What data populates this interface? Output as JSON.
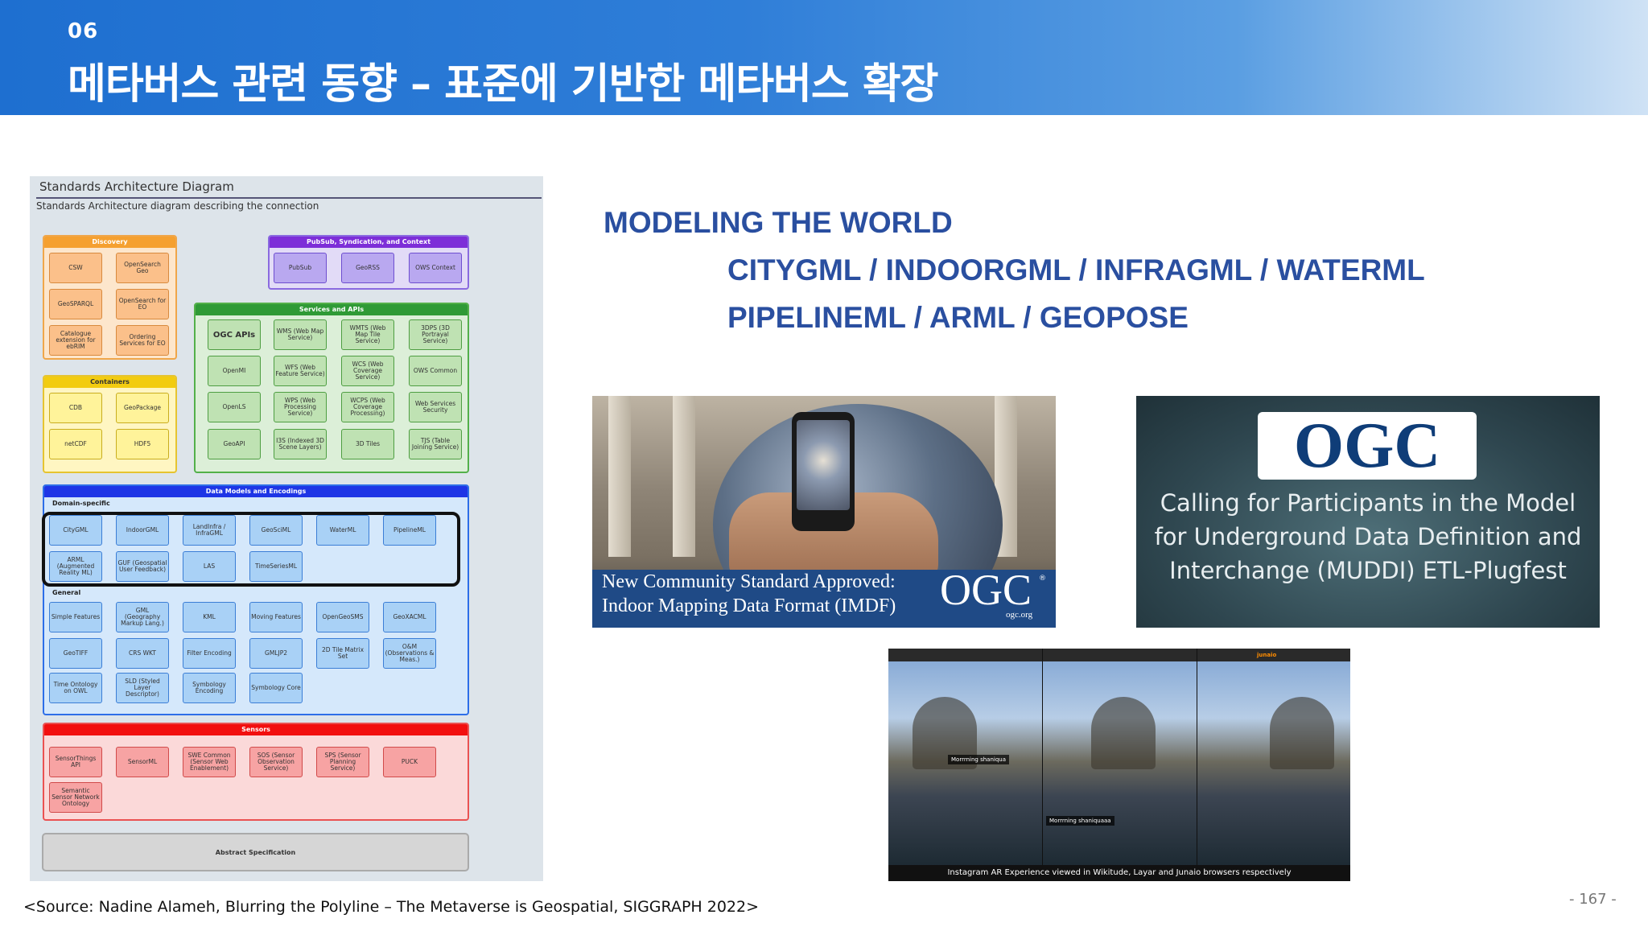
{
  "header": {
    "number": "06",
    "title": "메타버스 관련 동향 – 표준에 기반한 메타버스 확장"
  },
  "diagram": {
    "title": "Standards Architecture Diagram",
    "subtitle": "Standards Architecture diagram describing the connection",
    "groups": {
      "discovery": {
        "title": "Discovery",
        "items": [
          "CSW",
          "OpenSearch Geo",
          "GeoSPARQL",
          "OpenSearch for EO",
          "Catalogue extension for ebRIM",
          "Ordering Services for EO"
        ]
      },
      "containers": {
        "title": "Containers",
        "items": [
          "CDB",
          "GeoPackage",
          "netCDF",
          "HDF5"
        ]
      },
      "pubsub": {
        "title": "PubSub, Syndication, and Context",
        "items": [
          "PubSub",
          "GeoRSS",
          "OWS Context"
        ]
      },
      "services": {
        "title": "Services and APIs",
        "items": [
          "OGC APIs",
          "WMS (Web Map Service)",
          "WMTS (Web Map Tile Service)",
          "3DPS (3D Portrayal Service)",
          "OpenMI",
          "WFS (Web Feature Service)",
          "WCS (Web Coverage Service)",
          "OWS Common",
          "OpenLS",
          "WPS (Web Processing Service)",
          "WCPS (Web Coverage Processing)",
          "Web Services Security",
          "GeoAPI",
          "I3S (Indexed 3D Scene Layers)",
          "3D Tiles",
          "TJS (Table Joining Service)"
        ]
      },
      "datamodels": {
        "title": "Data Models and Encodings",
        "domain_label": "Domain-specific",
        "domain_items": [
          "CityGML",
          "IndoorGML",
          "LandInfra / InfraGML",
          "GeoSciML",
          "WaterML",
          "PipelineML",
          "ARML (Augmented Reality ML)",
          "GUF (Geospatial User Feedback)",
          "LAS",
          "TimeSeriesML"
        ],
        "general_label": "General",
        "general_items": [
          "Simple Features",
          "GML (Geography Markup Lang.)",
          "KML",
          "Moving Features",
          "OpenGeoSMS",
          "GeoXACML",
          "GeoTIFF",
          "CRS WKT",
          "Filter Encoding",
          "GMLJP2",
          "2D Tile Matrix Set",
          "O&M (Observations & Meas.)",
          "Time Ontology on OWL",
          "SLD (Styled Layer Descriptor)",
          "Symbology Encoding",
          "Symbology Core"
        ]
      },
      "sensors": {
        "title": "Sensors",
        "items": [
          "SensorThings API",
          "SensorML",
          "SWE Common (Sensor Web Enablement)",
          "SOS (Sensor Observation Service)",
          "SPS (Sensor Planning Service)",
          "PUCK",
          "Semantic Sensor Network Ontology"
        ]
      },
      "abstract": "Abstract Specification"
    }
  },
  "modeling": {
    "line1": "MODELING THE WORLD",
    "line2": "CITYGML / INDOORGML / INFRAGML / WATERML",
    "line3": "PIPELINEML / ARML / GEOPOSE"
  },
  "image1": {
    "caption_line1": "New Community Standard Approved:",
    "caption_line2": "Indoor Mapping Data Format (IMDF)",
    "logo": "OGC",
    "reg": "®",
    "url": "ogc.org"
  },
  "image2": {
    "logo": "OGC",
    "line1": "Calling for Participants in the Model",
    "line2": "for Underground Data Definition and",
    "line3": "Interchange (MUDDI) ETL-Plugfest"
  },
  "image3": {
    "caption": "Instagram AR Experience viewed in Wikitude, Layar and Junaio browsers respectively",
    "tag1": "Morrrning shaniqua",
    "tag2": "Morrrning shaniquaaa",
    "brand": "junaio"
  },
  "footer": {
    "source": "<Source: Nadine Alameh, Blurring the Polyline – The Metaverse is Geospatial, SIGGRAPH 2022>",
    "page": "- 167 -"
  }
}
